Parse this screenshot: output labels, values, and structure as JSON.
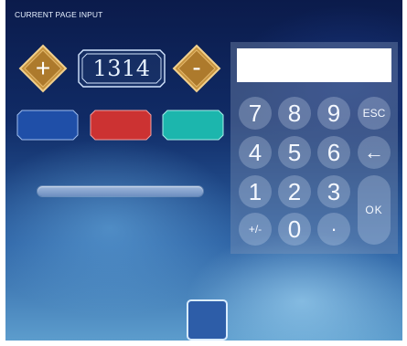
{
  "header": {
    "title": "CURRENT PAGE INPUT"
  },
  "controls": {
    "plus_label": "+",
    "minus_label": "-",
    "value": "1314"
  },
  "colors": {
    "background_top": "#0b1b4b",
    "background_bottom": "#5fa0cf",
    "gold": "#c48f3a",
    "blue_button": "#1f4fa8",
    "red_button": "#cc3232",
    "teal_button": "#1cb6ad",
    "bottom_square": "#2d5da8"
  },
  "color_buttons": [
    {
      "name": "blue",
      "color": "#1f4fa8"
    },
    {
      "name": "red",
      "color": "#cc3232"
    },
    {
      "name": "teal",
      "color": "#1cb6ad"
    }
  ],
  "slider": {
    "level": 1.0
  },
  "keypad": {
    "display_value": "",
    "keys": {
      "k7": "7",
      "k8": "8",
      "k9": "9",
      "esc": "ESC",
      "k4": "4",
      "k5": "5",
      "k6": "6",
      "back": "←",
      "k1": "1",
      "k2": "2",
      "k3": "3",
      "ok": "OK",
      "plusminus": "+/-",
      "k0": "0",
      "dot": "·"
    }
  }
}
